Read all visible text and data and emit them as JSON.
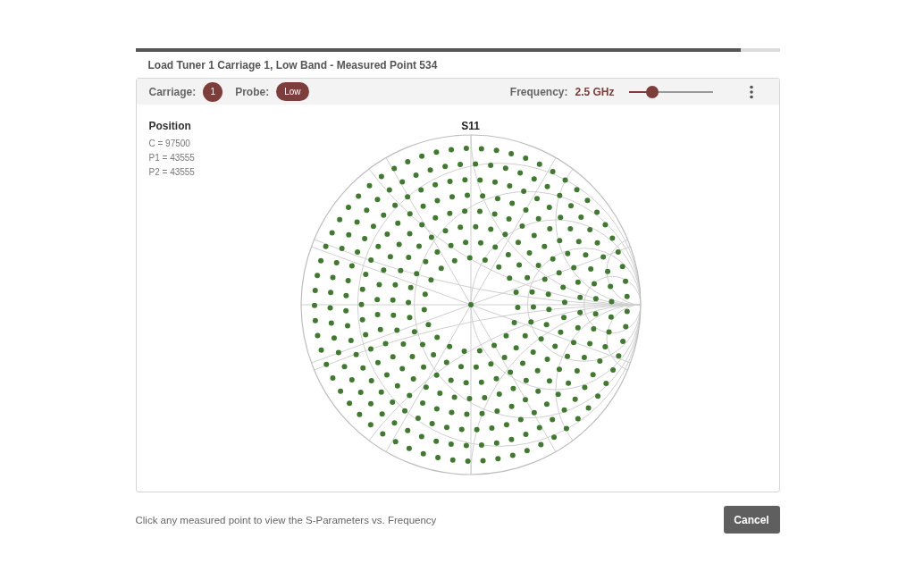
{
  "progress": {
    "level": 0.94
  },
  "dialog_title": "Load Tuner 1 Carriage 1, Low Band - Measured Point 534",
  "toolbar": {
    "carriage_label": "Carriage:",
    "carriage_value": "1",
    "probe_label": "Probe:",
    "probe_value": "Low",
    "frequency_label": "Frequency:",
    "frequency_value": "2.5 GHz",
    "frequency_slider": {
      "level": 0.28
    }
  },
  "position": {
    "heading": "Position",
    "lines": [
      "C = 97500",
      "P1 = 43555",
      "P2 = 43555"
    ]
  },
  "chart": {
    "title": "S11"
  },
  "footer": {
    "hint": "Click any measured point to view the S-Parameters vs. Frequency",
    "cancel_button": "Cancel"
  }
}
